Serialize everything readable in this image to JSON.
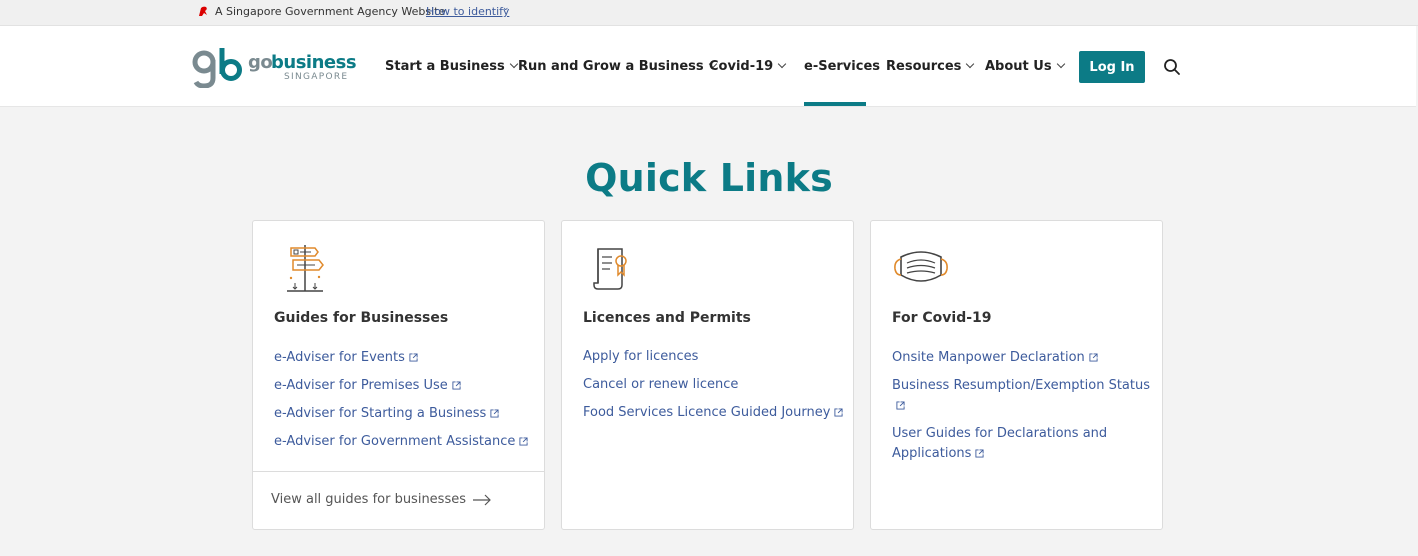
{
  "masthead": {
    "text": "A Singapore Government Agency Website",
    "identify_link": "How to identify"
  },
  "logo": {
    "go": "go",
    "business": "business",
    "country": "SINGAPORE"
  },
  "nav": {
    "items": [
      {
        "label": "Start a Business",
        "has_dropdown": true
      },
      {
        "label": "Run and Grow a Business",
        "has_dropdown": true
      },
      {
        "label": "Covid-19",
        "has_dropdown": true
      },
      {
        "label": "e-Services",
        "has_dropdown": false,
        "active": true
      },
      {
        "label": "Resources",
        "has_dropdown": true
      },
      {
        "label": "About Us",
        "has_dropdown": true
      }
    ],
    "login_label": "Log In",
    "search_icon": "search-icon"
  },
  "page": {
    "title": "Quick Links"
  },
  "cards": [
    {
      "icon": "signpost-icon",
      "title": "Guides for Businesses",
      "links": [
        {
          "label": "e-Adviser for Events",
          "external": true
        },
        {
          "label": "e-Adviser for Premises Use",
          "external": true
        },
        {
          "label": "e-Adviser for Starting a Business",
          "external": true
        },
        {
          "label": "e-Adviser for Government Assistance",
          "external": true
        }
      ],
      "footer": "View all guides for businesses"
    },
    {
      "icon": "certificate-icon",
      "title": "Licences and Permits",
      "links": [
        {
          "label": "Apply for licences",
          "external": false
        },
        {
          "label": "Cancel or renew licence",
          "external": false
        },
        {
          "label": "Food Services Licence Guided Journey",
          "external": true
        }
      ]
    },
    {
      "icon": "face-mask-icon",
      "title": "For Covid-19",
      "links": [
        {
          "label": "Onsite Manpower Declaration",
          "external": true
        },
        {
          "label": "Business Resumption/Exemption Status",
          "external": true
        },
        {
          "label": "User Guides for Declarations and Applications",
          "external": true
        }
      ]
    }
  ],
  "colors": {
    "brand": "#0c7b86",
    "link": "#3d5b9c",
    "accent_orange": "#e08a2c",
    "masthead_red": "#db0000"
  }
}
